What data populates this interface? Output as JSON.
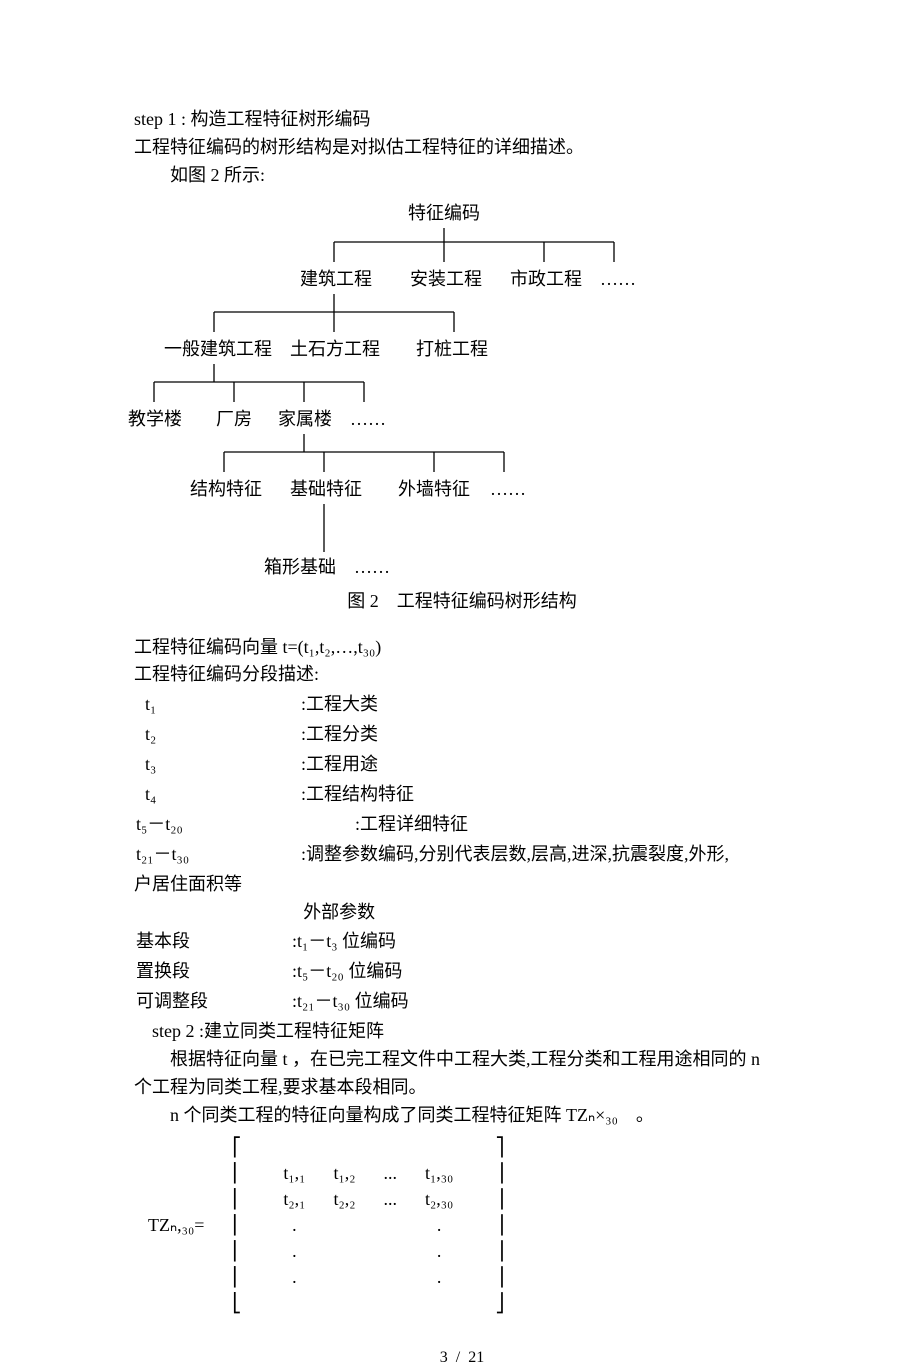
{
  "step1_title": "step 1 : 构造工程特征树形编码",
  "step1_desc": "工程特征编码的树形结构是对拟估工程特征的详细描述。",
  "step1_fig_intro": "如图 2 所示:",
  "tree": {
    "l0": "特征编码",
    "l1a": "建筑工程",
    "l1b": "安装工程",
    "l1c": "市政工程",
    "l1d": "……",
    "l2a": "一般建筑工程",
    "l2b": "土石方工程",
    "l2c": "打桩工程",
    "l3a": "教学楼",
    "l3b": "厂房",
    "l3c": "家属楼",
    "l3d": "……",
    "l4a": "结构特征",
    "l4b": "基础特征",
    "l4c": "外墙特征",
    "l4d": "……",
    "l5a": "箱形基础",
    "l5b": "……"
  },
  "fig_caption": "图 2 工程特征编码树形结构",
  "vec_line": "工程特征编码向量 t=(t₁,t₂,…,t₃₀)",
  "seg_heading": "工程特征编码分段描述:",
  "codes": [
    {
      "k": "t₁",
      "v": ":工程大类"
    },
    {
      "k": "t₂",
      "v": ":工程分类"
    },
    {
      "k": "t₃",
      "v": ":工程用途"
    },
    {
      "k": "t₄",
      "v": ":工程结构特征"
    },
    {
      "k": "t₅－t₂₀",
      "v": ":工程详细特征",
      "pad": true
    },
    {
      "k": "t₂₁－t₃₀",
      "v": ":调整参数编码,分别代表层数,层高,进深,抗震裂度,外形,"
    }
  ],
  "codes_cont": "户居住面积等",
  "outer_label": "外部参数",
  "segs": [
    {
      "k": "基本段",
      "v": ":t₁－t₃ 位编码"
    },
    {
      "k": "置换段",
      "v": ":t₅－t₂₀ 位编码"
    },
    {
      "k": "可调整段",
      "v": ":t₂₁－t₃₀ 位编码"
    }
  ],
  "step2_title": "step 2 :建立同类工程特征矩阵",
  "step2_p1a": "根据特征向量 t ，在已完工程文件中工程大类,工程分类和工程用途相同的 n",
  "step2_p1b": "个工程为同类工程,要求基本段相同。",
  "step2_p2": "n 个同类工程的特征向量构成了同类工程特征矩阵 TZₙ×₃₀ 。",
  "matrix": {
    "lhs": "TZₙ,₃₀=",
    "cells": [
      [
        "t₁,₁",
        "t₁,₂",
        "...",
        "t₁,₃₀"
      ],
      [
        "t₂,₁",
        "t₂,₂",
        "...",
        "t₂,₃₀"
      ],
      [
        ".",
        "",
        "",
        "."
      ],
      [
        ".",
        "",
        "",
        "."
      ],
      [
        ".",
        "",
        "",
        "."
      ]
    ]
  },
  "page_number": "3 / 21"
}
